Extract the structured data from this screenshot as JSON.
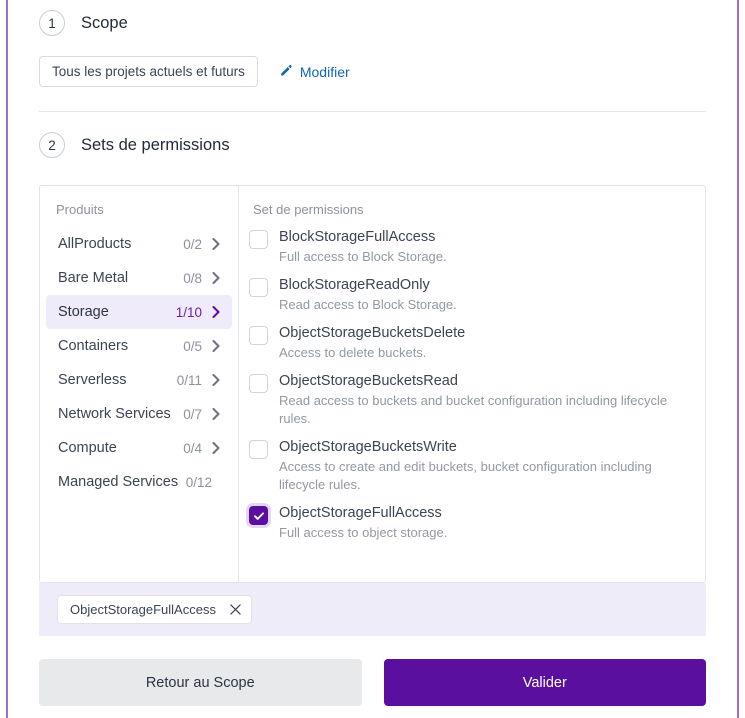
{
  "colors": {
    "accent_purple": "#5b0f9e",
    "selected_row_bg": "#efebfa",
    "chips_bar_bg": "#eeecf8",
    "link_blue": "#1166b5",
    "edge_border": "#9b6fd0"
  },
  "steps": [
    {
      "number": "1",
      "title": "Scope"
    },
    {
      "number": "2",
      "title": "Sets de permissions"
    }
  ],
  "scope": {
    "value_chip": "Tous les projets actuels et futurs",
    "edit_label": "Modifier",
    "edit_icon": "pencil-icon"
  },
  "panel": {
    "left_header": "Produits",
    "right_header": "Set de permissions",
    "products": [
      {
        "name": "AllProducts",
        "count": "0/2",
        "selected": false,
        "chevron": true
      },
      {
        "name": "Bare Metal",
        "count": "0/8",
        "selected": false,
        "chevron": true
      },
      {
        "name": "Storage",
        "count": "1/10",
        "selected": true,
        "chevron": true
      },
      {
        "name": "Containers",
        "count": "0/5",
        "selected": false,
        "chevron": true
      },
      {
        "name": "Serverless",
        "count": "0/11",
        "selected": false,
        "chevron": true
      },
      {
        "name": "Network Services",
        "count": "0/7",
        "selected": false,
        "chevron": true
      },
      {
        "name": "Compute",
        "count": "0/4",
        "selected": false,
        "chevron": true
      },
      {
        "name": "Managed Services",
        "count": "0/12",
        "selected": false,
        "chevron": false
      }
    ],
    "permissions": [
      {
        "name": "BlockStorageFullAccess",
        "description": "Full access to Block Storage.",
        "checked": false
      },
      {
        "name": "BlockStorageReadOnly",
        "description": "Read access to Block Storage.",
        "checked": false
      },
      {
        "name": "ObjectStorageBucketsDelete",
        "description": "Access to delete buckets.",
        "checked": false
      },
      {
        "name": "ObjectStorageBucketsRead",
        "description": "Read access to buckets and bucket configuration including lifecycle rules.",
        "checked": false
      },
      {
        "name": "ObjectStorageBucketsWrite",
        "description": "Access to create and edit buckets, bucket configuration including lifecycle rules.",
        "checked": false
      },
      {
        "name": "ObjectStorageFullAccess",
        "description": "Full access to object storage.",
        "checked": true
      }
    ]
  },
  "selected_chips": [
    {
      "label": "ObjectStorageFullAccess",
      "remove_icon": "close-icon"
    }
  ],
  "footer": {
    "back_label": "Retour au Scope",
    "validate_label": "Valider"
  }
}
